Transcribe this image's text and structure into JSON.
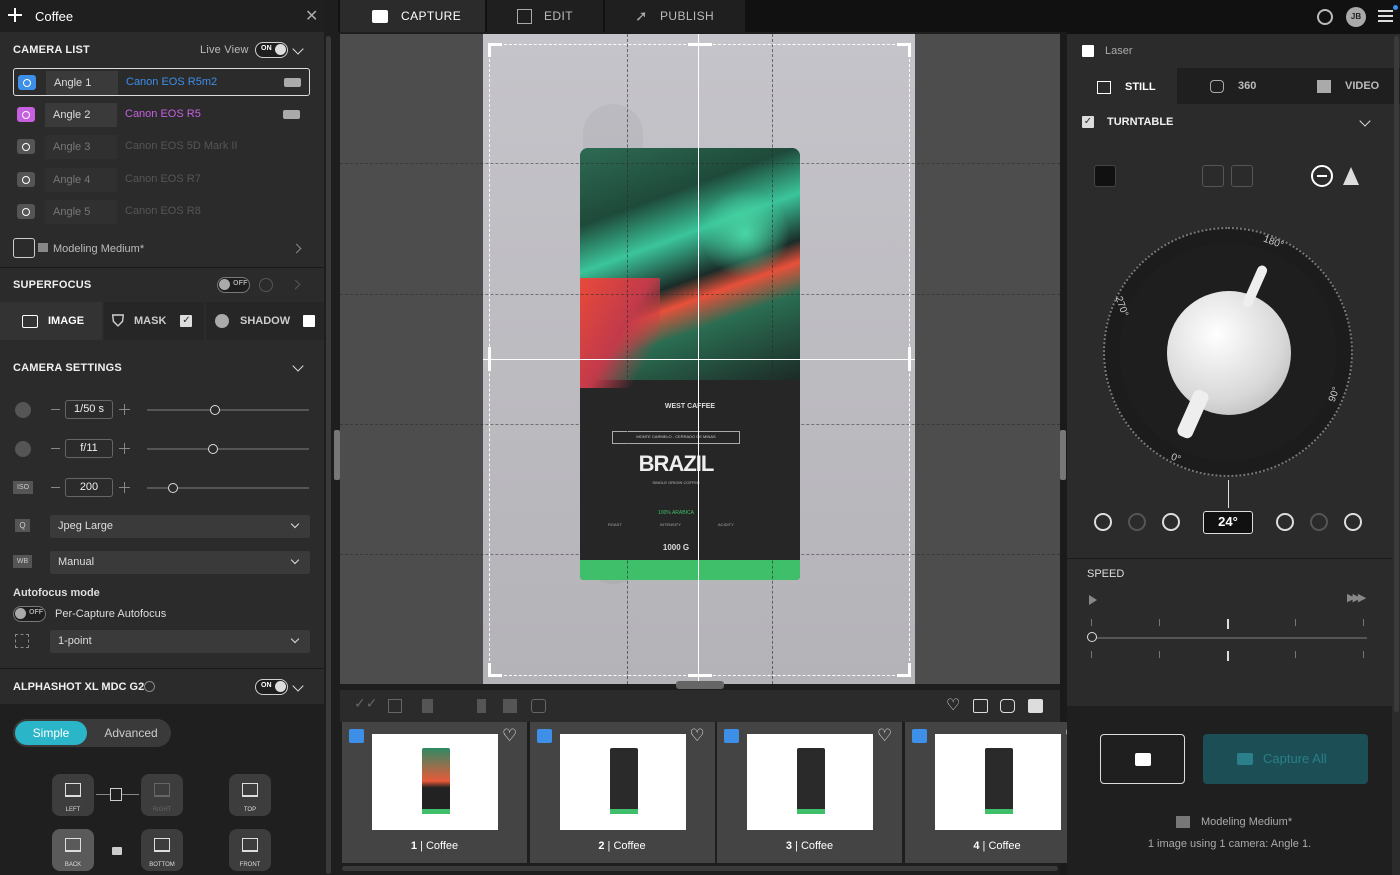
{
  "header": {
    "title": "Coffee"
  },
  "camera_list": {
    "title": "CAMERA LIST",
    "live_view_label": "Live View",
    "live_view_toggle": "ON",
    "cameras": [
      {
        "angle": "Angle 1",
        "model": "Canon EOS R5m2",
        "color": "#3d8fe8",
        "active": true
      },
      {
        "angle": "Angle 2",
        "model": "Canon EOS R5",
        "color": "#c660e0",
        "active": true
      },
      {
        "angle": "Angle 3",
        "model": "Canon EOS 5D Mark II",
        "color": "#555555",
        "active": false
      },
      {
        "angle": "Angle 4",
        "model": "Canon EOS R7",
        "color": "#555555",
        "active": false
      },
      {
        "angle": "Angle 5",
        "model": "Canon EOS R8",
        "color": "#555555",
        "active": false
      }
    ],
    "preset": "Modeling Medium*"
  },
  "superfocus": {
    "title": "SUPERFOCUS",
    "toggle": "OFF"
  },
  "image_tabs": {
    "image": "IMAGE",
    "mask": "MASK",
    "shadow": "SHADOW"
  },
  "camera_settings": {
    "title": "CAMERA SETTINGS",
    "shutter": "1/50 s",
    "shutter_pos": 0.42,
    "aperture": "f/11",
    "aperture_pos": 0.41,
    "iso": "200",
    "iso_pos": 0.16,
    "quality": "Jpeg Large",
    "white_balance": "Manual",
    "autofocus_title": "Autofocus mode",
    "af_toggle": "OFF",
    "af_label": "Per-Capture Autofocus",
    "af_point": "1-point",
    "icons": {
      "iso": "ISO",
      "quality": "Q",
      "wb": "WB"
    }
  },
  "device": {
    "title": "ALPHASHOT XL MDC G2",
    "toggle": "ON",
    "mode_simple": "Simple",
    "mode_advanced": "Advanced",
    "positions": {
      "left": "LEFT",
      "right": "RIGHT",
      "top": "TOP",
      "back": "BACK",
      "bottom": "BOTTOM",
      "front": "FRONT"
    }
  },
  "tabs": {
    "capture": "CAPTURE",
    "edit": "EDIT",
    "publish": "PUBLISH"
  },
  "user": {
    "initials": "JB"
  },
  "product": {
    "brand": "WEST CAFFEE",
    "origin": "MONTE CARMELO - CERRADO DE MINAS",
    "name": "BRAZIL",
    "sub": "SINGLE ORIGIN COFFEE",
    "arabica": "100% ARABICA",
    "roast": "ROAST",
    "intensity": "INTENSITY",
    "acidity": "ACIDITY",
    "weight": "1000 G"
  },
  "thumbnails": [
    {
      "num": "1",
      "name": "Coffee"
    },
    {
      "num": "2",
      "name": "Coffee"
    },
    {
      "num": "3",
      "name": "Coffee"
    },
    {
      "num": "4",
      "name": "Coffee"
    }
  ],
  "right": {
    "laser": "Laser",
    "still": "STILL",
    "t360": "360",
    "video": "VIDEO",
    "turntable": "TURNTABLE",
    "dial": {
      "d180": "180°",
      "d270": "270°",
      "d90": "90°",
      "d0": "0°"
    },
    "angle_value": "24°",
    "speed": "SPEED",
    "capture_all": "Capture All",
    "preset": "Modeling Medium*",
    "summary": "1 image using 1 camera: Angle 1."
  }
}
